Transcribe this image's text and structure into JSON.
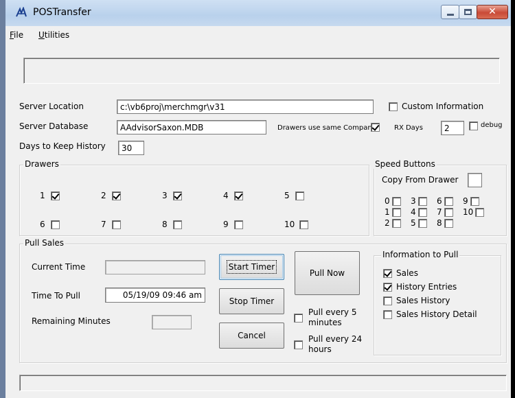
{
  "window": {
    "title": "POSTransfer"
  },
  "menu": {
    "file": "File",
    "utilities": "Utilities"
  },
  "server": {
    "location_label": "Server Location",
    "location_value": "c:\\vb6proj\\merchmgr\\v31",
    "database_label": "Server Database",
    "database_value": "AAdvisorSaxon.MDB",
    "history_label": "Days to Keep History",
    "history_value": "30",
    "custom_info_label": "Custom Information",
    "custom_info_checked": false,
    "same_company_label": "Drawers use same Company",
    "same_company_checked": true,
    "rx_days_label": "RX Days",
    "rx_days_value": "2",
    "debug_label": "debug",
    "debug_checked": false
  },
  "drawers": {
    "title": "Drawers",
    "items": [
      {
        "label": "1",
        "checked": true
      },
      {
        "label": "2",
        "checked": true
      },
      {
        "label": "3",
        "checked": true
      },
      {
        "label": "4",
        "checked": true
      },
      {
        "label": "5",
        "checked": false
      },
      {
        "label": "6",
        "checked": false
      },
      {
        "label": "7",
        "checked": false
      },
      {
        "label": "8",
        "checked": false
      },
      {
        "label": "9",
        "checked": false
      },
      {
        "label": "10",
        "checked": false
      }
    ]
  },
  "speed": {
    "title": "Speed Buttons",
    "copy_label": "Copy From Drawer",
    "copy_checked": false,
    "items": [
      {
        "label": "0",
        "checked": false
      },
      {
        "label": "3",
        "checked": false
      },
      {
        "label": "6",
        "checked": false
      },
      {
        "label": "9",
        "checked": false
      },
      {
        "label": "1",
        "checked": false
      },
      {
        "label": "4",
        "checked": false
      },
      {
        "label": "7",
        "checked": false
      },
      {
        "label": "10",
        "checked": false
      },
      {
        "label": "2",
        "checked": false
      },
      {
        "label": "5",
        "checked": false
      },
      {
        "label": "8",
        "checked": false
      }
    ]
  },
  "pull": {
    "title": "Pull Sales",
    "current_time_label": "Current Time",
    "current_time_value": "",
    "time_to_pull_label": "Time To Pull",
    "time_to_pull_value": "05/19/09 09:46 am",
    "remaining_label": "Remaining Minutes",
    "remaining_value": "",
    "start_timer": "Start Timer",
    "stop_timer": "Stop Timer",
    "cancel": "Cancel",
    "pull_now": "Pull Now",
    "every5_line1": "Pull every 5",
    "every5_line2": "minutes",
    "every5_checked": false,
    "every24_line1": "Pull every 24",
    "every24_line2": "hours",
    "every24_checked": false
  },
  "info": {
    "title": "Information to Pull",
    "items": [
      {
        "label": "Sales",
        "checked": true
      },
      {
        "label": "History Entries",
        "checked": true
      },
      {
        "label": "Sales History",
        "checked": false
      },
      {
        "label": "Sales History Detail",
        "checked": false
      }
    ]
  },
  "colors": {
    "titlebar": "#b9d1ec",
    "close": "#c94a37",
    "face": "#f0f0f0"
  }
}
